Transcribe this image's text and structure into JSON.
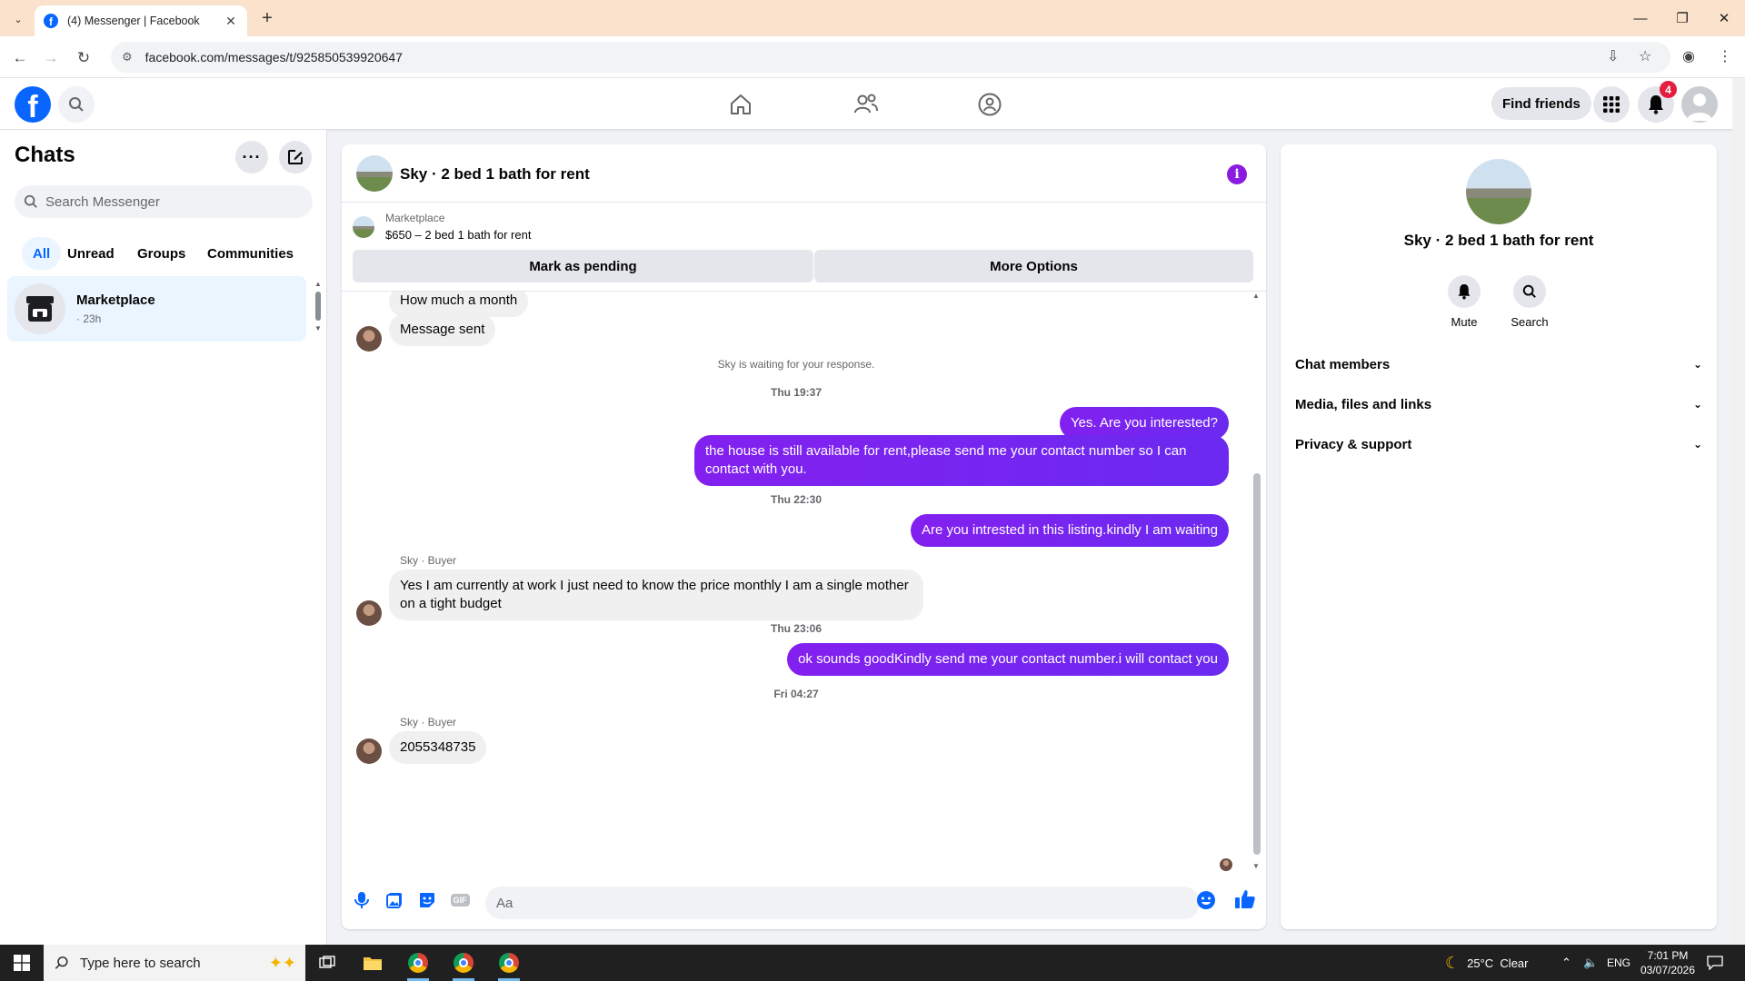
{
  "browser": {
    "tab_title": "(4) Messenger | Facebook",
    "url": "facebook.com/messages/t/925850539920647"
  },
  "header": {
    "find_friends": "Find friends",
    "notification_count": "4"
  },
  "sidebar": {
    "title": "Chats",
    "search_placeholder": "Search Messenger",
    "filters": [
      "All",
      "Unread",
      "Groups",
      "Communities"
    ],
    "chats": [
      {
        "name": "Marketplace",
        "time": "· 23h"
      }
    ]
  },
  "conversation": {
    "title": "Sky · 2 bed 1 bath for rent",
    "listing": {
      "source": "Marketplace",
      "price_title": "$650 – 2 bed 1 bath for rent",
      "mark_pending": "Mark as pending",
      "more_options": "More Options"
    },
    "messages": {
      "m1": "How much a month",
      "m2": "Message sent",
      "waiting_note": "Sky is waiting for your response.",
      "ts1": "Thu 19:37",
      "m3": "Yes. Are you interested?",
      "m4": "the house is still available for rent,please send me your contact number so I can contact with you.",
      "ts2": "Thu 22:30",
      "m5": "Are you intrested in this listing.kindly I am waiting",
      "sender1": "Sky · Buyer",
      "m6": "Yes I am currently at work I just need to know the price monthly I am a single mother on a tight budget",
      "ts3": "Thu 23:06",
      "m7": "ok sounds goodKindly send me your contact number.i will contact you",
      "ts4": "Fri 04:27",
      "sender2": "Sky · Buyer",
      "m8": "2055348735"
    },
    "composer_placeholder": "Aa"
  },
  "info_panel": {
    "title": "Sky · 2 bed 1 bath for rent",
    "actions": [
      "Mute",
      "Search"
    ],
    "sections": [
      "Chat members",
      "Media, files and links",
      "Privacy & support"
    ]
  },
  "taskbar": {
    "search_placeholder": "Type here to search",
    "weather": "25°C  Clear",
    "language": "ENG",
    "time": "7:01 PM",
    "date": "03/07/2026"
  },
  "colors": {
    "brand": "#0866ff",
    "outgoing_bubble": "#7f23f5",
    "incoming_bubble": "#f0f0f0"
  }
}
